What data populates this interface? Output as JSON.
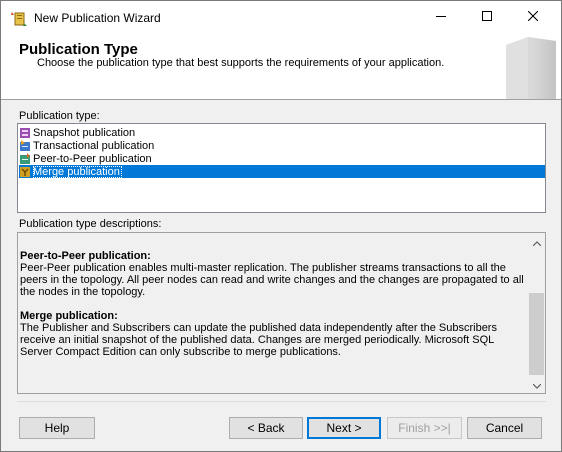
{
  "window": {
    "title": "New Publication Wizard",
    "icon": "publication-wizard-icon"
  },
  "header": {
    "title": "Publication Type",
    "subtitle": "Choose the publication type that best supports the requirements of your application."
  },
  "publication_type": {
    "label": "Publication type:",
    "items": [
      {
        "label": "Snapshot publication",
        "icon": "snapshot-publication-icon",
        "selected": false
      },
      {
        "label": "Transactional publication",
        "icon": "transactional-publication-icon",
        "selected": false
      },
      {
        "label": "Peer-to-Peer publication",
        "icon": "peer-to-peer-publication-icon",
        "selected": false
      },
      {
        "label": "Merge publication",
        "icon": "merge-publication-icon",
        "selected": true
      }
    ]
  },
  "descriptions": {
    "label": "Publication type descriptions:",
    "sections": [
      {
        "heading": "Peer-to-Peer publication:",
        "text": "Peer-Peer publication enables multi-master replication. The publisher streams transactions to all the peers in the topology. All peer nodes can read and write changes and the changes are propagated to all the nodes in the topology."
      },
      {
        "heading": "Merge publication:",
        "text": "The Publisher and Subscribers can update the published data independently after the Subscribers receive an initial snapshot of the published data. Changes are merged periodically. Microsoft SQL Server Compact Edition can only subscribe to merge publications."
      }
    ]
  },
  "buttons": {
    "help": "Help",
    "back": "< Back",
    "next": "Next >",
    "finish": "Finish >>|",
    "cancel": "Cancel"
  },
  "colors": {
    "selection": "#0078d7",
    "window_bg": "#f0f0f0",
    "disabled_text": "#a0a0a0"
  }
}
